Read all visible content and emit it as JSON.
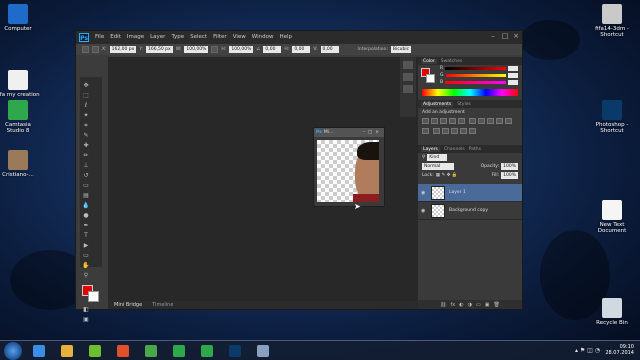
{
  "desktop": {
    "icons_left": [
      {
        "label": "Computer",
        "icon": "computer-icon",
        "color": "#1e6bc9"
      },
      {
        "label": "fifa my creation",
        "icon": "folder-icon",
        "color": "#f0f0f0"
      },
      {
        "label": "Camtasia Studio 8",
        "icon": "camtasia-icon",
        "color": "#2ea84a"
      },
      {
        "label": "Cristiano-...",
        "icon": "photo-icon",
        "color": "#9a7a5a"
      }
    ],
    "icons_right": [
      {
        "label": "fifa14-3dm - Shortcut",
        "icon": "fifa-shortcut-icon",
        "color": "#c9c9c9"
      },
      {
        "label": "Photoshop - Shortcut",
        "icon": "photoshop-icon",
        "color": "#0a3a6a"
      },
      {
        "label": "New Text Document",
        "icon": "text-document-icon",
        "color": "#f5f5f5"
      },
      {
        "label": "Recycle Bin",
        "icon": "recycle-bin-icon",
        "color": "#d0d8e0"
      }
    ]
  },
  "photoshop": {
    "logo": "Ps",
    "menu": [
      "File",
      "Edit",
      "Image",
      "Layer",
      "Type",
      "Select",
      "Filter",
      "View",
      "Window",
      "Help"
    ],
    "options": {
      "x_label": "X:",
      "x_value": "162,00 px",
      "y_label": "Y:",
      "y_value": "166,50 px",
      "w_label": "W:",
      "w_value": "100,00%",
      "h_label": "H:",
      "h_value": "100,00%",
      "angle_value": "0,00",
      "h2_label": "H:",
      "h2_value": "0,00",
      "v_label": "V:",
      "v_value": "0,00",
      "interpolation_label": "Interpolation:",
      "interpolation_value": "Bicubic"
    },
    "document": {
      "title": "Mi..."
    },
    "bottom_tabs": [
      "Mini Bridge",
      "Timeline"
    ],
    "color_panel": {
      "tabs": [
        "Color",
        "Swatches"
      ]
    },
    "adjustments_panel": {
      "tabs": [
        "Adjustments",
        "Styles"
      ],
      "add_label": "Add an adjustment"
    },
    "layers_panel": {
      "tabs": [
        "Layers",
        "Channels",
        "Paths"
      ],
      "kind_label": "Kind",
      "blend_mode": "Normal",
      "opacity_label": "Opacity:",
      "opacity_value": "100%",
      "lock_label": "Lock:",
      "fill_label": "Fill:",
      "fill_value": "100%",
      "layers": [
        {
          "name": "Layer 1",
          "active": true
        },
        {
          "name": "Background copy",
          "active": false
        }
      ]
    },
    "colors": {
      "foreground": "#e00000",
      "background": "#ffffff"
    }
  },
  "taskbar": {
    "time": "09:10",
    "date": "28.07.2014",
    "apps": [
      {
        "icon": "ie-icon",
        "color": "#3a8ee6"
      },
      {
        "icon": "explorer-icon",
        "color": "#e8b23a"
      },
      {
        "icon": "utorrent-icon",
        "color": "#6cbf2e"
      },
      {
        "icon": "media-icon",
        "color": "#e0502a"
      },
      {
        "icon": "chrome-icon",
        "color": "#4aa84a"
      },
      {
        "icon": "camtasia-icon",
        "color": "#2ea84a"
      },
      {
        "icon": "camtasia-recorder-icon",
        "color": "#2ea84a"
      },
      {
        "icon": "photoshop-icon",
        "color": "#0a3a6a"
      },
      {
        "icon": "window-icon",
        "color": "#8aa0c0"
      }
    ]
  }
}
